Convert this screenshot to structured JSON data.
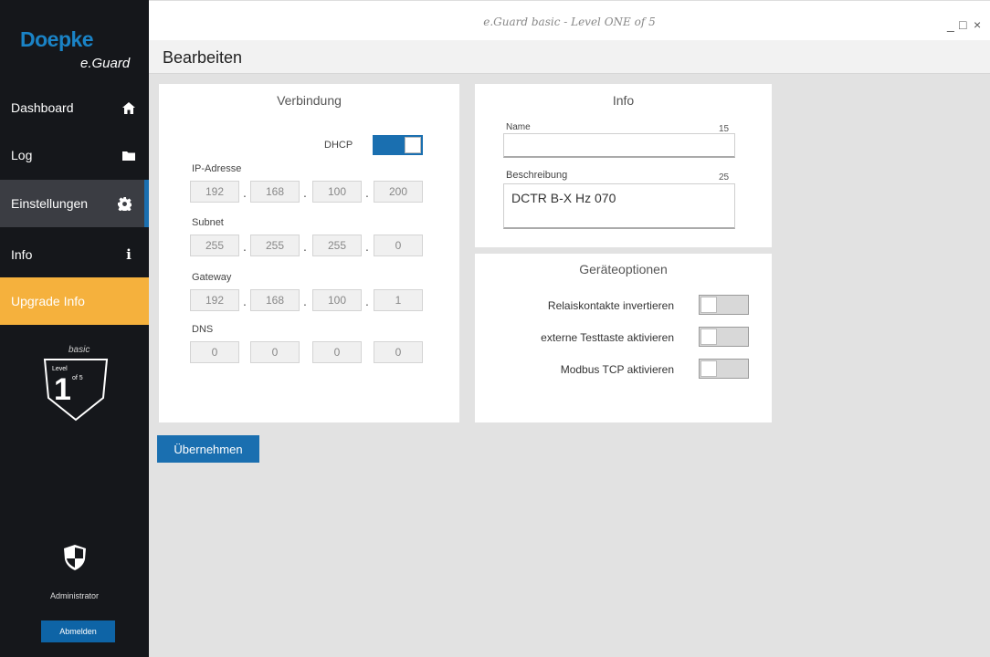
{
  "window": {
    "title": "e.Guard basic - Level ONE of 5",
    "minimize": "_",
    "maximize": "□",
    "close": "×"
  },
  "sidebar": {
    "brand": "Doepke",
    "brand_sub": "e.Guard",
    "items": [
      {
        "label": "Dashboard",
        "icon": "home-icon"
      },
      {
        "label": "Log",
        "icon": "folder-icon"
      },
      {
        "label": "Einstellungen",
        "icon": "gear-icon"
      },
      {
        "label": "Info",
        "icon": "info-icon"
      },
      {
        "label": "Upgrade Info"
      }
    ],
    "level": {
      "edition": "basic",
      "word": "Level",
      "number": "1",
      "of": "of 5"
    },
    "user": "Administrator",
    "logout_label": "Abmelden"
  },
  "page": {
    "title": "Bearbeiten"
  },
  "connection": {
    "title": "Verbindung",
    "dhcp_label": "DHCP",
    "dhcp_on": true,
    "ip_label": "IP-Adresse",
    "ip": [
      "192",
      "168",
      "100",
      "200"
    ],
    "subnet_label": "Subnet",
    "subnet": [
      "255",
      "255",
      "255",
      "0"
    ],
    "gateway_label": "Gateway",
    "gateway": [
      "192",
      "168",
      "100",
      "1"
    ],
    "dns_label": "DNS",
    "dns": [
      "0",
      "0",
      "0",
      "0"
    ]
  },
  "info": {
    "title": "Info",
    "name_label": "Name",
    "name_value": "",
    "name_counter": "15",
    "desc_label": "Beschreibung",
    "desc_value": "DCTR B-X Hz 070",
    "desc_counter": "25"
  },
  "device_options": {
    "title": "Geräteoptionen",
    "options": [
      {
        "label": "Relaiskontakte invertieren",
        "on": false
      },
      {
        "label": "externe Testtaste aktivieren",
        "on": false
      },
      {
        "label": "Modbus TCP aktivieren",
        "on": false
      }
    ]
  },
  "apply_label": "Übernehmen",
  "colors": {
    "accent": "#1a6fb0",
    "upgrade": "#f5b13d",
    "sidebar": "#15171b"
  }
}
